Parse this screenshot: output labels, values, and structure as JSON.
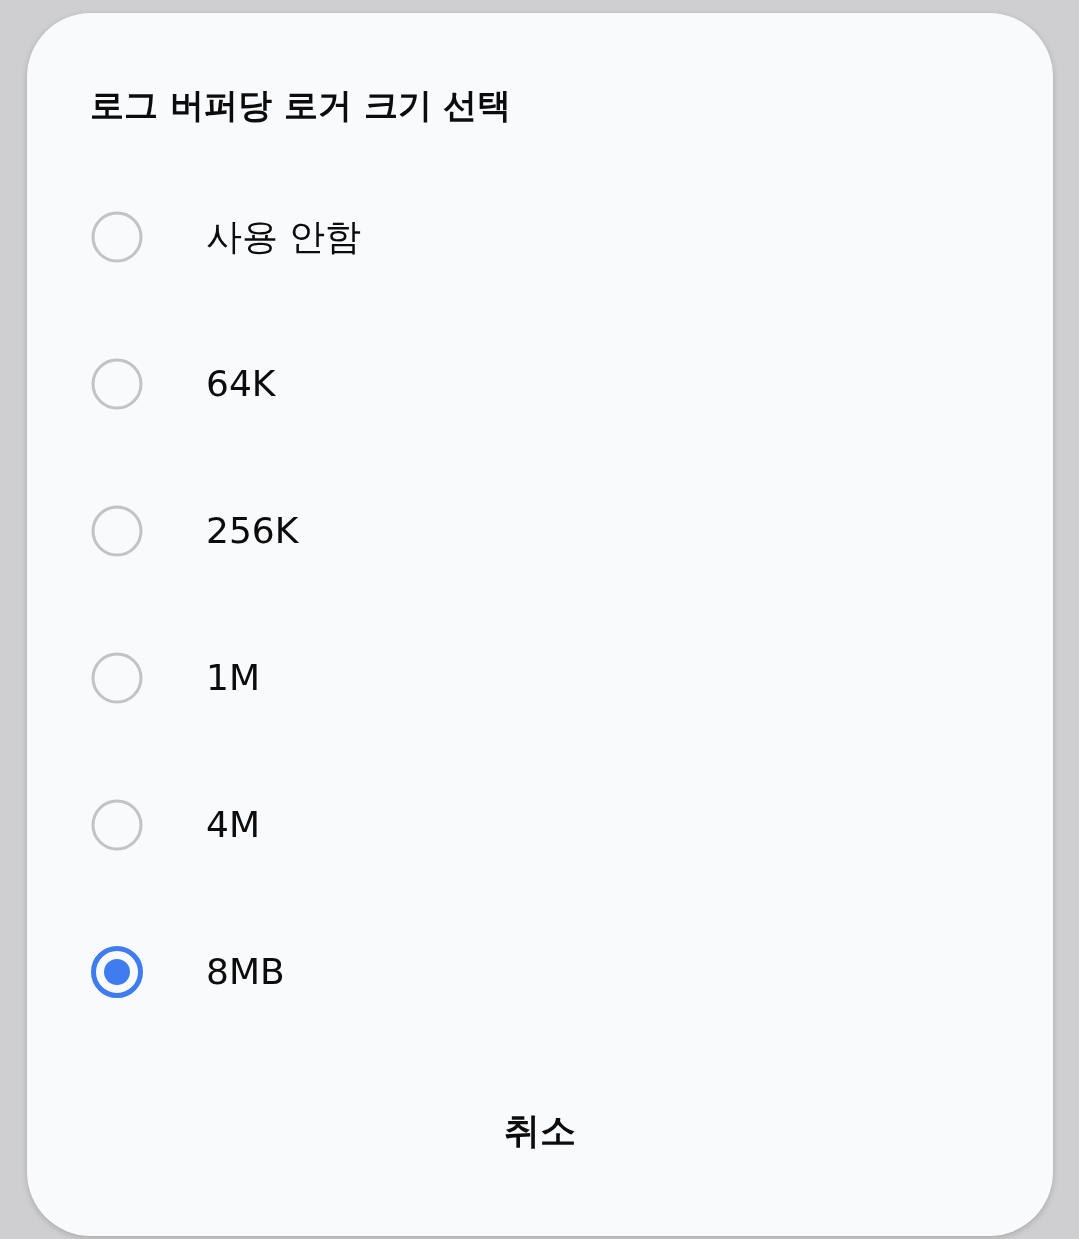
{
  "dialog": {
    "title": "로그 버퍼당 로거 크기 선택",
    "options": [
      {
        "label": "사용 안함",
        "selected": false
      },
      {
        "label": "64K",
        "selected": false
      },
      {
        "label": "256K",
        "selected": false
      },
      {
        "label": "1M",
        "selected": false
      },
      {
        "label": "4M",
        "selected": false
      },
      {
        "label": "8MB",
        "selected": true
      }
    ],
    "buttons": [
      "취소"
    ]
  }
}
